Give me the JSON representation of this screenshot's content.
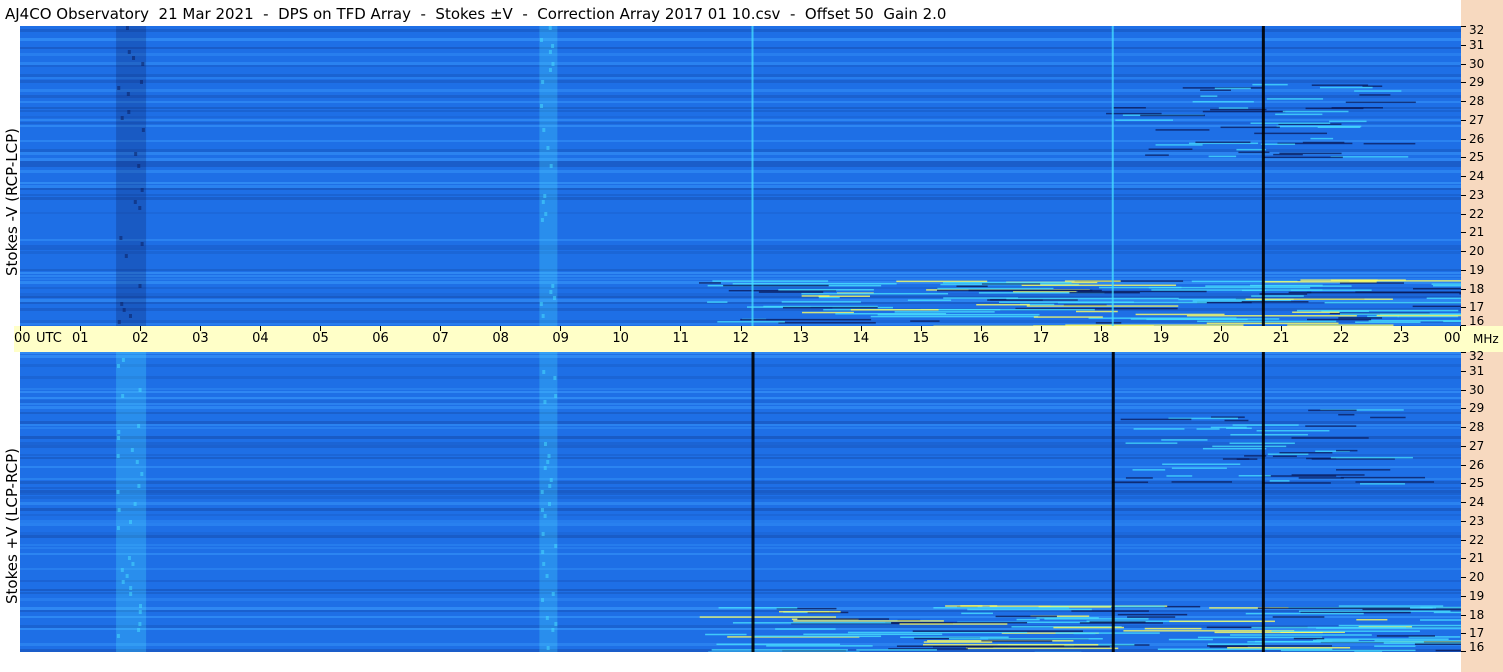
{
  "window": {
    "title": "AJ4CO Observatory  21 Mar 2021  -  DPS on TFD Array  -  Stokes ±V  -  Correction Array 2017 01 10.csv  -  Offset 50  Gain 2.0"
  },
  "colors": {
    "background_blue": "#1e6fe6",
    "light_blue": "#3fa0ff",
    "cyan": "#47e0ff",
    "dark_navy": "#0a1a5a",
    "black_line": "#000000",
    "yellow": "#ffff60",
    "time_axis_bg": "#ffffc8",
    "freq_axis_bg": "#f7d9bf"
  },
  "chart_data": [
    {
      "type": "heatmap",
      "panel": "top",
      "ylabel": "Stokes -V (RCP-LCP)",
      "x_unit": "UTC",
      "y_unit": "MHz",
      "xlim": [
        0,
        24
      ],
      "ylim": [
        16,
        32
      ],
      "x_ticks": [
        "00",
        "01",
        "02",
        "03",
        "04",
        "05",
        "06",
        "07",
        "08",
        "09",
        "10",
        "11",
        "12",
        "13",
        "14",
        "15",
        "16",
        "17",
        "18",
        "19",
        "20",
        "21",
        "22",
        "23",
        "00"
      ],
      "y_ticks": [
        16,
        17,
        18,
        19,
        20,
        21,
        22,
        23,
        24,
        25,
        26,
        27,
        28,
        29,
        30,
        31,
        32
      ],
      "vertical_lines": [
        {
          "utc": 12.2,
          "color": "light"
        },
        {
          "utc": 18.2,
          "color": "light"
        },
        {
          "utc": 20.7,
          "color": "dark"
        }
      ],
      "bands": [
        {
          "utc_start": 1.6,
          "utc_end": 2.1,
          "tone": "dark"
        },
        {
          "utc_start": 8.65,
          "utc_end": 8.95,
          "tone": "bright"
        }
      ],
      "noise_region": {
        "utc_start": 11.3,
        "utc_end": 24,
        "mhz_start": 16,
        "mhz_end": 18.5
      }
    },
    {
      "type": "heatmap",
      "panel": "bottom",
      "ylabel": "Stokes +V (LCP-RCP)",
      "x_unit": "UTC",
      "y_unit": "MHz",
      "xlim": [
        0,
        24
      ],
      "ylim": [
        16,
        32
      ],
      "x_ticks": [
        "00",
        "01",
        "02",
        "03",
        "04",
        "05",
        "06",
        "07",
        "08",
        "09",
        "10",
        "11",
        "12",
        "13",
        "14",
        "15",
        "16",
        "17",
        "18",
        "19",
        "20",
        "21",
        "22",
        "23",
        "00"
      ],
      "y_ticks": [
        16,
        17,
        18,
        19,
        20,
        21,
        22,
        23,
        24,
        25,
        26,
        27,
        28,
        29,
        30,
        31,
        32
      ],
      "vertical_lines": [
        {
          "utc": 12.2,
          "color": "dark"
        },
        {
          "utc": 18.2,
          "color": "dark"
        },
        {
          "utc": 20.7,
          "color": "dark"
        }
      ],
      "bands": [
        {
          "utc_start": 1.6,
          "utc_end": 2.1,
          "tone": "bright"
        },
        {
          "utc_start": 8.65,
          "utc_end": 8.95,
          "tone": "bright"
        }
      ],
      "noise_region": {
        "utc_start": 11.3,
        "utc_end": 24,
        "mhz_start": 16,
        "mhz_end": 18.5
      }
    }
  ],
  "time_axis": {
    "utc_label": "UTC",
    "unit_label": "MHz"
  }
}
